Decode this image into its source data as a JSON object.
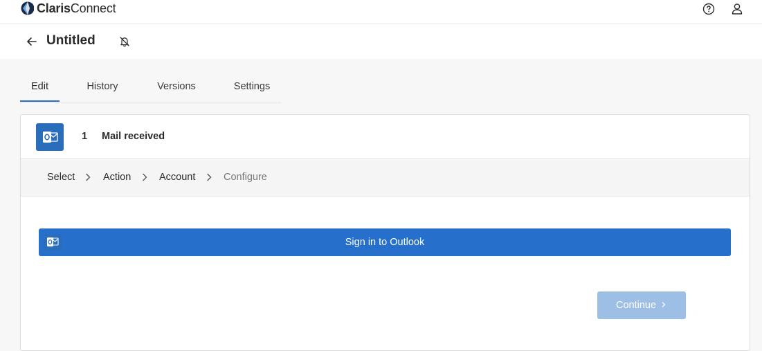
{
  "brand": {
    "name_bold": "Claris",
    "name_light": "Connect"
  },
  "header": {
    "icons": [
      "help-icon",
      "user-icon"
    ]
  },
  "flow": {
    "title": "Untitled",
    "back_icon": "arrow-left-icon",
    "notification_icon": "bell-off-icon"
  },
  "tabs": [
    {
      "label": "Edit",
      "active": true
    },
    {
      "label": "History",
      "active": false
    },
    {
      "label": "Versions",
      "active": false
    },
    {
      "label": "Settings",
      "active": false
    }
  ],
  "step": {
    "number": "1",
    "name": "Mail received",
    "app_icon": "outlook-icon"
  },
  "breadcrumb": [
    {
      "label": "Select",
      "current": false
    },
    {
      "label": "Action",
      "current": false
    },
    {
      "label": "Account",
      "current": false
    },
    {
      "label": "Configure",
      "current": true
    }
  ],
  "signin": {
    "label": "Sign in to Outlook",
    "icon": "outlook-icon"
  },
  "continue_button": {
    "label": "Continue",
    "enabled": false
  },
  "colors": {
    "accent": "#2670cc",
    "outlook_blue": "#2a6ebb",
    "disabled_button": "#9dbfe6"
  }
}
